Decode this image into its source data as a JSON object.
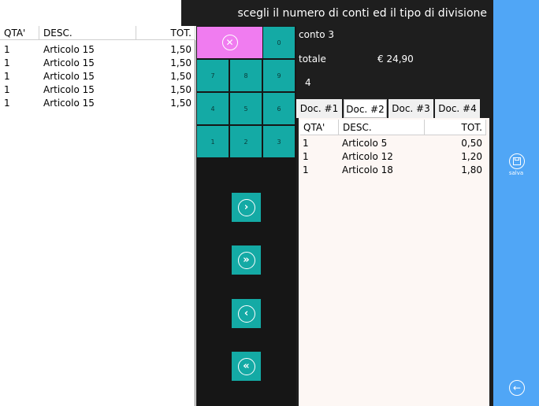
{
  "header": {
    "title": "scegli il numero di conti ed il tipo di divisione"
  },
  "left_list": {
    "columns": {
      "qty": "QTA'",
      "desc": "DESC.",
      "tot": "TOT."
    },
    "rows": [
      {
        "qty": "1",
        "desc": "Articolo 15",
        "tot": "1,50"
      },
      {
        "qty": "1",
        "desc": "Articolo 15",
        "tot": "1,50"
      },
      {
        "qty": "1",
        "desc": "Articolo 15",
        "tot": "1,50"
      },
      {
        "qty": "1",
        "desc": "Articolo 15",
        "tot": "1,50"
      },
      {
        "qty": "1",
        "desc": "Articolo 15",
        "tot": "1,50"
      }
    ]
  },
  "keypad": {
    "clear_icon": "close-circle-icon",
    "keys": {
      "k0": "0",
      "k1": "1",
      "k2": "2",
      "k3": "3",
      "k4": "4",
      "k5": "5",
      "k6": "6",
      "k7": "7",
      "k8": "8",
      "k9": "9"
    },
    "nav_icons": [
      "chevron-right-circle-icon",
      "double-chevron-right-circle-icon",
      "chevron-left-circle-icon",
      "double-chevron-left-circle-icon"
    ]
  },
  "info": {
    "conto": "conto 3",
    "totale_label": "totale",
    "totale_value": "€ 24,90",
    "count": "4"
  },
  "docs": {
    "tabs": [
      "Doc. #1",
      "Doc. #2",
      "Doc. #3",
      "Doc. #4"
    ],
    "active_tab": 1,
    "columns": {
      "qty": "QTA'",
      "desc": "DESC.",
      "tot": "TOT."
    },
    "rows": [
      {
        "qty": "1",
        "desc": "Articolo 5",
        "tot": "0,50"
      },
      {
        "qty": "1",
        "desc": "Articolo 12",
        "tot": "1,20"
      },
      {
        "qty": "1",
        "desc": "Articolo 18",
        "tot": "1,80"
      }
    ]
  },
  "sidebar": {
    "save_label": "salva",
    "save_icon": "save-icon",
    "back_icon": "back-arrow-icon"
  },
  "colors": {
    "accent": "#14aaa5",
    "clear": "#f07cf0",
    "sidebar": "#50a6f6",
    "dark": "#1e1e1e"
  }
}
